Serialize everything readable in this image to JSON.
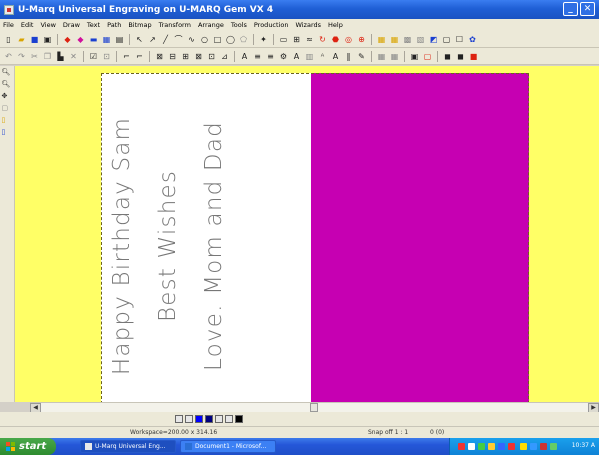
{
  "window": {
    "title": "U-Marq Universal Engraving   on   U-MARQ Gem VX 4",
    "minimize_label": "_",
    "close_label": "✕"
  },
  "menu": [
    "File",
    "Edit",
    "View",
    "Draw",
    "Text",
    "Path",
    "Bitmap",
    "Transform",
    "Arrange",
    "Tools",
    "Production",
    "Wizards",
    "Help"
  ],
  "card": {
    "lines": [
      "Happy Birthday Sam",
      "Best Wishes",
      "Love. Mom and Dad"
    ],
    "left_panel_color": "#ffffff",
    "right_panel_color": "#c600b2",
    "workspace_color": "#ffff66"
  },
  "status": {
    "workspace": "Workspace=200.00 x 314.16",
    "snap": "Snap off  1 : 1",
    "count": "0 (0)"
  },
  "taskbar": {
    "start_label": "start",
    "task_umarq": "U-Marq Universal Eng...",
    "task_document": "Document1 - Microsof...",
    "clock": "10:37 A"
  }
}
